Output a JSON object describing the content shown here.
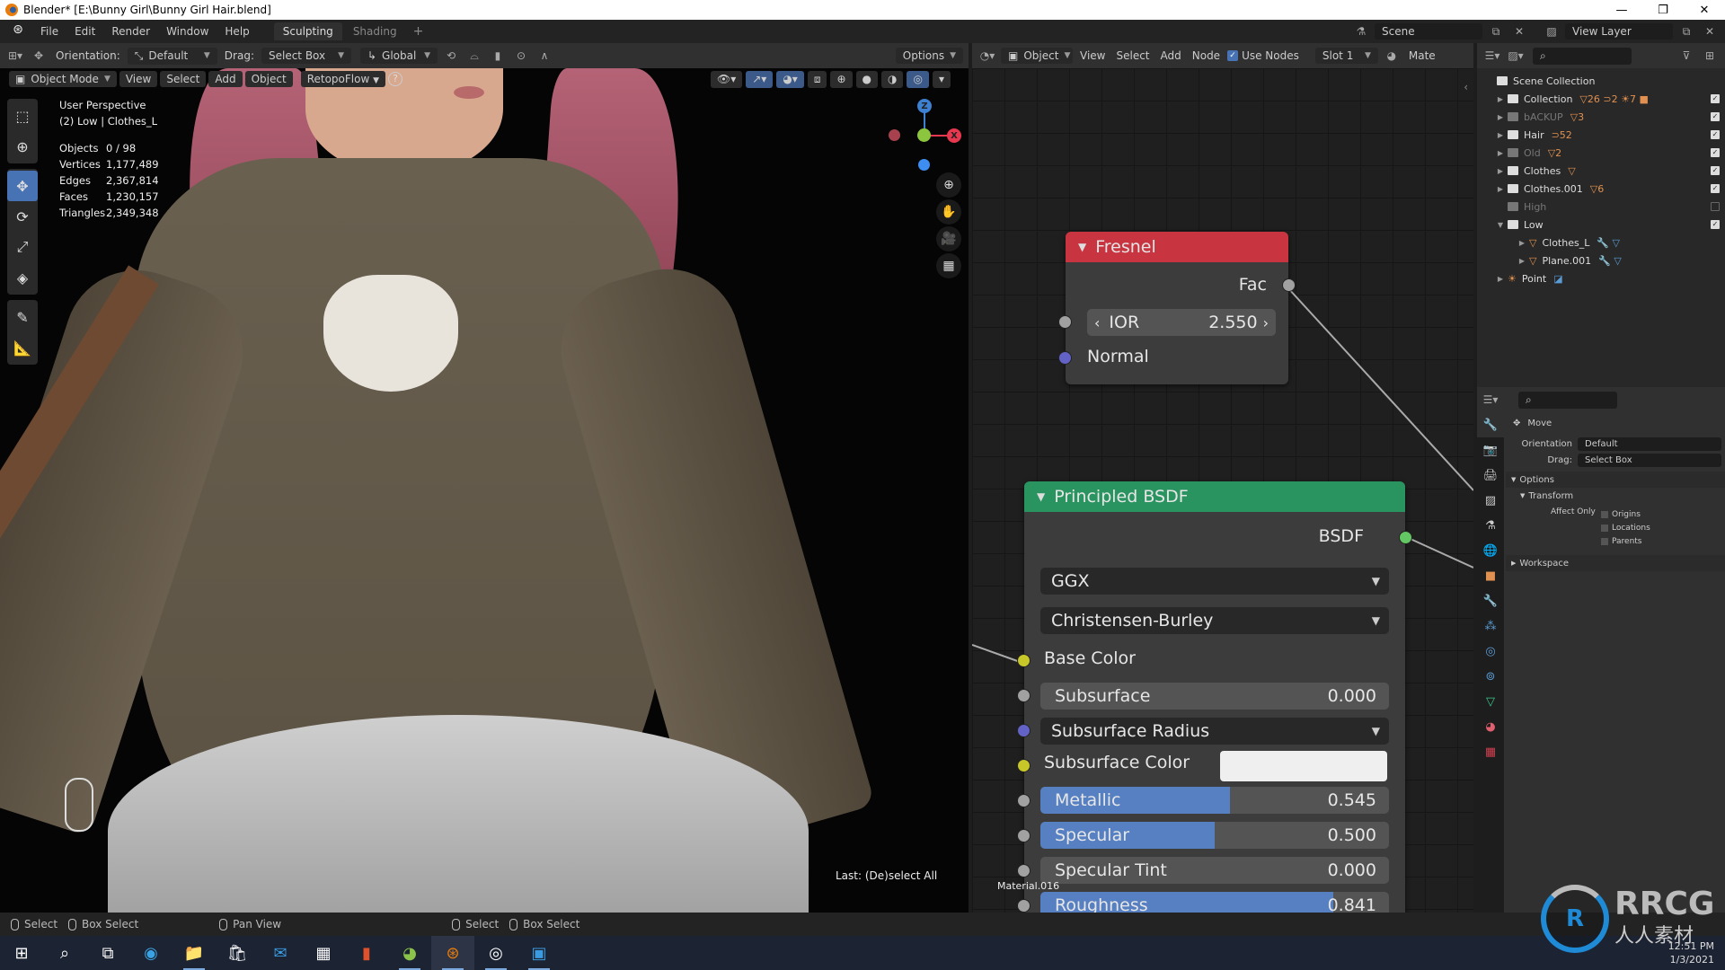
{
  "window": {
    "title": "Blender* [E:\\Bunny Girl\\Bunny Girl Hair.blend]",
    "controls": [
      "—",
      "❐",
      "✕"
    ]
  },
  "menubar": {
    "items": [
      "File",
      "Edit",
      "Render",
      "Window",
      "Help"
    ],
    "workspaces": [
      {
        "label": "Sculpting",
        "active": true
      },
      {
        "label": "Shading",
        "active": false
      }
    ],
    "add_workspace": "+",
    "scene": "Scene",
    "view_layer": "View Layer"
  },
  "tool_header": {
    "orientation_label": "Orientation:",
    "orientation_value": "Default",
    "drag_label": "Drag:",
    "drag_value": "Select Box",
    "transform_space": "Global",
    "options": "Options"
  },
  "viewport": {
    "mode": "Object Mode",
    "menus": [
      "View",
      "Select",
      "Add",
      "Object"
    ],
    "addon": "RetopoFlow",
    "help": "?",
    "view_name": "User Perspective",
    "collection_info": "(2) Low | Clothes_L",
    "stats": [
      {
        "k": "Objects",
        "v": "0 / 98"
      },
      {
        "k": "Vertices",
        "v": "1,177,489"
      },
      {
        "k": "Edges",
        "v": "2,367,814"
      },
      {
        "k": "Faces",
        "v": "1,230,157"
      },
      {
        "k": "Triangles",
        "v": "2,349,348"
      }
    ],
    "gizmo": {
      "z": "Z",
      "x": "X",
      "colors": {
        "x": "#e8384f",
        "y": "#8cc63e",
        "z": "#3d7fd1"
      }
    },
    "last_operator": "Last: (De)select All"
  },
  "node_editor": {
    "header": {
      "context": "Object",
      "menus": [
        "View",
        "Select",
        "Add",
        "Node"
      ],
      "use_nodes_label": "Use Nodes",
      "use_nodes": true,
      "slot": "Slot 1",
      "material_short": "Mate"
    },
    "material_label": "Material.016",
    "fresnel": {
      "title": "Fresnel",
      "color": "#c8343f",
      "output": "Fac",
      "ior_label": "IOR",
      "ior_value": "2.550",
      "normal_label": "Normal"
    },
    "bsdf": {
      "title": "Principled BSDF",
      "color": "#2a9461",
      "output": "BSDF",
      "distribution": "GGX",
      "subsurface_method": "Christensen-Burley",
      "base_color_label": "Base Color",
      "subsurface": {
        "label": "Subsurface",
        "value": "0.000",
        "fraction": 0
      },
      "subsurface_radius": "Subsurface Radius",
      "subsurface_color": "Subsurface Color",
      "metallic": {
        "label": "Metallic",
        "value": "0.545",
        "fraction": 0.545
      },
      "specular": {
        "label": "Specular",
        "value": "0.500",
        "fraction": 0.5
      },
      "specular_tint": {
        "label": "Specular Tint",
        "value": "0.000",
        "fraction": 0
      },
      "roughness": {
        "label": "Roughness",
        "value": "0.841",
        "fraction": 0.841
      }
    }
  },
  "outliner": {
    "root": "Scene Collection",
    "items": [
      {
        "name": "Collection",
        "dim": false,
        "badge": "▽26 ⊃2 ☀7 ■",
        "checked": true
      },
      {
        "name": "bACKUP",
        "dim": true,
        "badge": "▽3",
        "checked": true
      },
      {
        "name": "Hair",
        "dim": false,
        "badge": "⊃52",
        "checked": true
      },
      {
        "name": "Old",
        "dim": true,
        "badge": "▽2",
        "checked": true
      },
      {
        "name": "Clothes",
        "dim": false,
        "badge": "▽",
        "checked": true
      },
      {
        "name": "Clothes.001",
        "dim": false,
        "badge": "▽6",
        "checked": true
      },
      {
        "name": "High",
        "dim": true,
        "badge": "",
        "checked": false
      },
      {
        "name": "Low",
        "dim": false,
        "badge": "",
        "checked": true,
        "expanded": true
      },
      {
        "name": "Clothes_L",
        "dim": false,
        "badge": "🔧 ▽",
        "child": true
      },
      {
        "name": "Plane.001",
        "dim": false,
        "badge": "🔧 ▽",
        "child": true
      },
      {
        "name": "Point",
        "dim": false,
        "badge": "◪",
        "light": true
      }
    ]
  },
  "properties": {
    "tool_name": "Move",
    "orientation_label": "Orientation",
    "orientation_value": "Default",
    "drag_label": "Drag:",
    "drag_value": "Select Box",
    "options": "Options",
    "transform": "Transform",
    "affect_only": "Affect Only",
    "affect_items": [
      "Origins",
      "Locations",
      "Parents"
    ],
    "workspace": "Workspace"
  },
  "statusbar": {
    "items": [
      "Select",
      "Box Select",
      "Pan View",
      "Select",
      "Box Select"
    ]
  },
  "taskbar": {
    "time": "12:51 PM",
    "date": "1/3/2021"
  },
  "watermark": {
    "brand": "RRCG",
    "cn": "人人素材"
  }
}
